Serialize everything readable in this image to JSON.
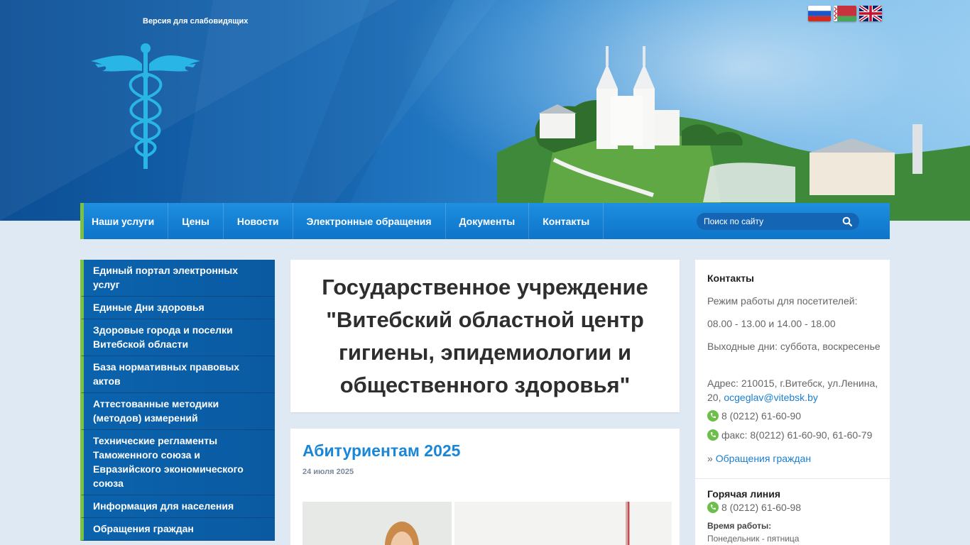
{
  "header": {
    "low_vision_link": "Версия для слабовидящих",
    "flags": [
      "russian-flag-icon",
      "belarusian-flag-icon",
      "english-flag-icon"
    ]
  },
  "nav": {
    "items": [
      "Наши услуги",
      "Цены",
      "Новости",
      "Электронные обращения",
      "Документы",
      "Контакты"
    ],
    "search_placeholder": "Поиск по сайту"
  },
  "sidebar": {
    "items": [
      "Единый портал электронных услуг",
      "Единые Дни здоровья",
      "Здоровые города и поселки Витебской области",
      "База нормативных правовых актов",
      "Аттестованные методики (методов) измерений",
      "Технические регламенты Таможенного союза и Евразийского экономического союза",
      "Информация для населения",
      "Обращения граждан"
    ]
  },
  "main": {
    "title": "Государственное учреждение \"Витебский областной центр гигиены, эпидемиологии и общественного здоровья\"",
    "news": {
      "title": "Абитуриентам 2025",
      "date": "24 июля 2025"
    }
  },
  "contacts": {
    "heading": "Контакты",
    "hours_label": "Режим работы для посетителей:",
    "hours": "08.00 - 13.00 и 14.00 - 18.00",
    "days_off": "Выходные дни: суббота, воскресенье",
    "address_prefix": "Адрес: 210015, г.Витебск, ул.Ленина, 20, ",
    "email": "ocgeglav@vitebsk.by",
    "phone": "8 (0212) 61-60-90",
    "fax": "факс: 8(0212) 61-60-90, 61-60-79",
    "appeals_prefix": "» ",
    "appeals_link": "Обращения граждан",
    "hotline_heading": "Горячая линия",
    "hotline_phone": "8 (0212) 61-60-98",
    "work_time_label": "Время работы:",
    "work_days": "Понедельник - пятница"
  },
  "colors": {
    "nav_blue": "#0d74c9",
    "sidebar_blue": "#0b63ad",
    "accent_green": "#7cc242",
    "link_blue": "#1a86d8"
  }
}
